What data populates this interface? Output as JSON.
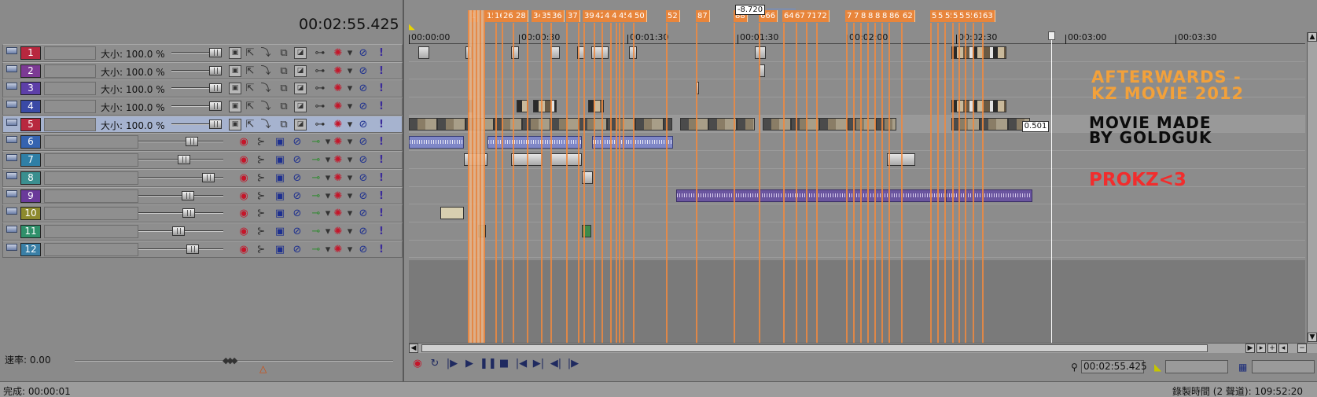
{
  "header": {
    "timecode": "00:02:55.425"
  },
  "video_tracks": [
    {
      "num": "1",
      "color": "#b8283f",
      "size_label": "大小:",
      "size_value": "100.0 %"
    },
    {
      "num": "2",
      "color": "#7c3a94",
      "size_label": "大小:",
      "size_value": "100.0 %"
    },
    {
      "num": "3",
      "color": "#5d3fa8",
      "size_label": "大小:",
      "size_value": "100.0 %"
    },
    {
      "num": "4",
      "color": "#3a4aa6",
      "size_label": "大小:",
      "size_value": "100.0 %"
    },
    {
      "num": "5",
      "color": "#b8283f",
      "size_label": "大小:",
      "size_value": "100.0 %"
    }
  ],
  "audio_tracks": [
    {
      "num": "6",
      "color": "#3563b0"
    },
    {
      "num": "7",
      "color": "#2f7fa6"
    },
    {
      "num": "8",
      "color": "#3a8f8f"
    },
    {
      "num": "9",
      "color": "#6a3a9a"
    },
    {
      "num": "10",
      "color": "#8d8a2e"
    },
    {
      "num": "11",
      "color": "#2f8f6a"
    },
    {
      "num": "12",
      "color": "#3a7fa6"
    }
  ],
  "speed": {
    "label": "速率: 0.00"
  },
  "timeline": {
    "ruler_labels": [
      "00:00:00",
      "00:00:30",
      "00:01:30",
      "00:01:30",
      "00:02:00",
      "00:02:30",
      "00:03:00",
      "00:03:30"
    ],
    "markers": [
      "1",
      "15",
      "16",
      "26",
      "28",
      "34",
      "35",
      "36",
      "37",
      "39",
      "42",
      "43",
      "44",
      "45",
      "49",
      "50",
      "52",
      "87",
      "88",
      "666",
      "64",
      "67",
      "71",
      "72",
      "77",
      "78",
      "88",
      "88",
      "88",
      "88",
      "86",
      "62",
      "5",
      "5",
      "55",
      "5",
      "5",
      "55",
      "61",
      "63"
    ],
    "time_tag": "-8.720",
    "clip_tag": "0.501"
  },
  "overlay": {
    "title_line1": "AFTERWARDS -",
    "title_line2": "KZ MOVIE 2012",
    "credit_line1": "MOVIE MADE",
    "credit_line2": "BY GOLDGUK",
    "tag": "PROKZ<3"
  },
  "transport": {
    "cursor_position": "00:02:55.425"
  },
  "status": {
    "left": "完成: 00:00:01",
    "right": "錄製時間 (2 聲道): 109:52:20"
  },
  "icons": [
    "collapse-icon",
    "fx-icon",
    "motion-icon",
    "compositing-icon",
    "mute-icon",
    "solo-icon",
    "arm-record-icon",
    "invert-phase-icon",
    "automation-icon",
    "play-icon",
    "stop-icon",
    "pause-icon",
    "loop-icon"
  ]
}
